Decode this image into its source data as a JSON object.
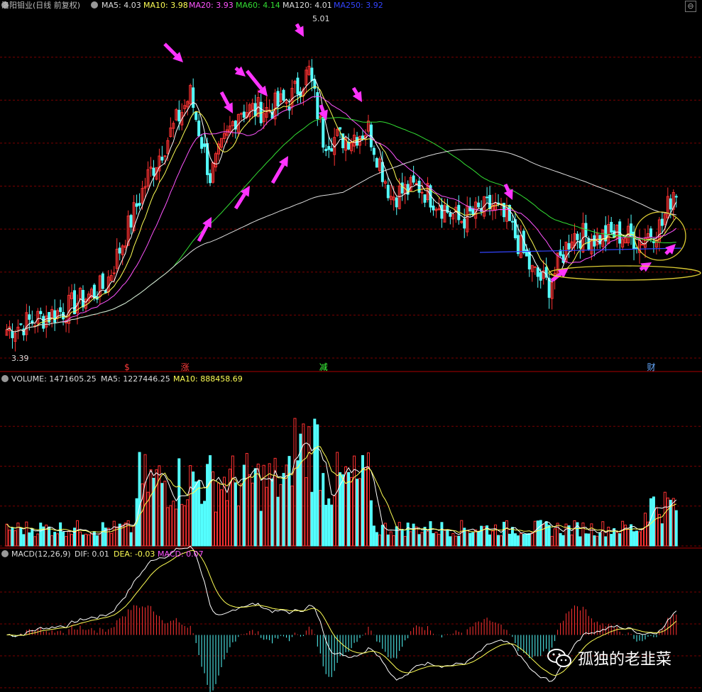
{
  "header": {
    "title": "洛阳钼业(日线 前复权)",
    "ma5": "MA5: 4.03",
    "ma10": "MA10: 3.98",
    "ma20": "MA20: 3.93",
    "ma60": "MA60: 4.14",
    "ma120": "MA120: 4.01",
    "ma250": "MA250: 3.92"
  },
  "volume_header": {
    "volume": "VOLUME: 1471605.25",
    "ma5": "MA5: 1227446.25",
    "ma10": "MA10: 888458.69"
  },
  "macd_header": {
    "name": "MACD(12,26,9)",
    "dif": "DIF: 0.01",
    "dea": "DEA: -0.03",
    "macd": "MACD: 0.07"
  },
  "price_labels": {
    "high": "5.01",
    "low": "3.39"
  },
  "events": [
    {
      "label": "$",
      "bar": 43,
      "color": "#ff3b3b"
    },
    {
      "label": "涨",
      "bar": 63,
      "color": "#ff3b3b"
    },
    {
      "label": "减",
      "bar": 112,
      "color": "#3dff3d"
    },
    {
      "label": "财",
      "bar": 228,
      "color": "#66aaff"
    }
  ],
  "watermark": "孤独的老韭菜",
  "colors": {
    "up": "#ff3232",
    "down": "#54ffff",
    "ma5": "#ffffff",
    "ma10": "#ffff55",
    "ma20": "#ff55ff",
    "ma60": "#33dd33",
    "ma120": "#dddddd",
    "ma250": "#3344ff",
    "grid": "#7a0000",
    "arrow": "#ff33ff"
  },
  "chart_data": {
    "type": "candlestick",
    "price_range": [
      3.3,
      5.1
    ],
    "high": 5.01,
    "low": 3.39,
    "trend_anchors": [
      {
        "bar": 0,
        "close": 3.45
      },
      {
        "bar": 20,
        "close": 3.55
      },
      {
        "bar": 35,
        "close": 3.68
      },
      {
        "bar": 50,
        "close": 4.25
      },
      {
        "bar": 65,
        "close": 4.68
      },
      {
        "bar": 72,
        "close": 4.25
      },
      {
        "bar": 82,
        "close": 4.6
      },
      {
        "bar": 92,
        "close": 4.6
      },
      {
        "bar": 100,
        "close": 4.65
      },
      {
        "bar": 107,
        "close": 4.8
      },
      {
        "bar": 112,
        "close": 4.45
      },
      {
        "bar": 120,
        "close": 4.45
      },
      {
        "bar": 128,
        "close": 4.5
      },
      {
        "bar": 136,
        "close": 4.15
      },
      {
        "bar": 146,
        "close": 4.2
      },
      {
        "bar": 160,
        "close": 4.02
      },
      {
        "bar": 172,
        "close": 4.1
      },
      {
        "bar": 178,
        "close": 4.0
      },
      {
        "bar": 186,
        "close": 3.75
      },
      {
        "bar": 192,
        "close": 3.68
      },
      {
        "bar": 200,
        "close": 3.95
      },
      {
        "bar": 208,
        "close": 3.93
      },
      {
        "bar": 216,
        "close": 3.95
      },
      {
        "bar": 224,
        "close": 3.92
      },
      {
        "bar": 232,
        "close": 4.0
      },
      {
        "bar": 236,
        "close": 4.18
      }
    ],
    "volume_range": [
      0,
      2600000
    ],
    "macd_range": [
      -0.12,
      0.17
    ]
  }
}
